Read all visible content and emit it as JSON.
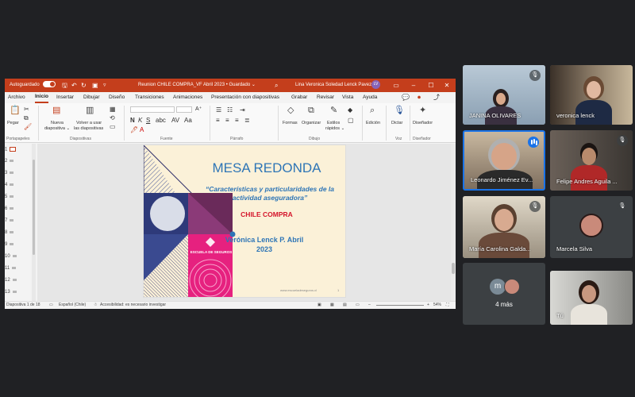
{
  "titlebar": {
    "autosave_label": "Autoguardado",
    "doc_title": "Reunion CHILE COMPRA_VF Abril 2023 • Guardado ⌄",
    "user_name": "Lina Veronica Soledad Lenck Pavez",
    "user_initials": "LV"
  },
  "menu_tabs": [
    "Archivo",
    "Inicio",
    "Insertar",
    "Dibujar",
    "Diseño",
    "Transiciones",
    "Animaciones",
    "Presentación con diapositivas",
    "Grabar",
    "Revisar",
    "Vista",
    "Ayuda"
  ],
  "ribbon": {
    "paste": "Pegar",
    "new_slide": "Nueva",
    "new_slide2": "diapositiva ⌄",
    "reuse": "Volver a usar",
    "reuse2": "las diapositivas",
    "shapes": "Formas",
    "arrange": "Organizar",
    "styles": "Estilos",
    "styles2": "rápidos ⌄",
    "editing": "Edición",
    "dictate": "Dictar",
    "designer": "Diseñador",
    "group_clipboard": "Portapapeles",
    "group_slides": "Diapositivas",
    "group_font": "Fuente",
    "group_paragraph": "Párrafo",
    "group_drawing": "Dibujo",
    "group_voice": "Voz",
    "group_designer": "Diseñador"
  },
  "thumbnails": [
    "1",
    "2",
    "3",
    "4",
    "5",
    "6",
    "7",
    "8",
    "9",
    "10",
    "11",
    "12",
    "13"
  ],
  "slide": {
    "title": "MESA REDONDA",
    "subtitle": "“Características y particularidades de la actividad aseguradora”",
    "client": "CHILE COMPRA",
    "author": "Verónica Lenck P. Abril 2023",
    "logo_text": "ESCUELA DE SEGUROS",
    "url": "www.escueladeseguros.cl",
    "page": "1"
  },
  "statusbar": {
    "slide_count": "Diapositiva 1 de 18",
    "language": "Español (Chile)",
    "accessibility": "Accesibilidad: es necesario investigar",
    "zoom": "54%"
  },
  "participants": [
    {
      "name": "JANINA OLIVARES",
      "mic": "muted"
    },
    {
      "name": "veronica lenck",
      "mic": "on"
    },
    {
      "name": "Leonardo Jiménez Ev...",
      "mic": "speaking"
    },
    {
      "name": "Felipe Andres Aguila ...",
      "mic": "muted"
    },
    {
      "name": "María Carolina Galda...",
      "mic": "muted"
    },
    {
      "name": "Marcela Silva",
      "mic": "muted"
    },
    {
      "name": "4 más",
      "avatar_initial": "m"
    },
    {
      "name": "Tú",
      "mic": "on"
    }
  ],
  "colors": {
    "ppt_accent": "#c43e1c",
    "meet_background": "#202124",
    "speaking_blue": "#1a73e8",
    "slide_title_blue": "#2e75b6",
    "slide_red": "#d4142a",
    "logo_pink": "#e6217f"
  }
}
